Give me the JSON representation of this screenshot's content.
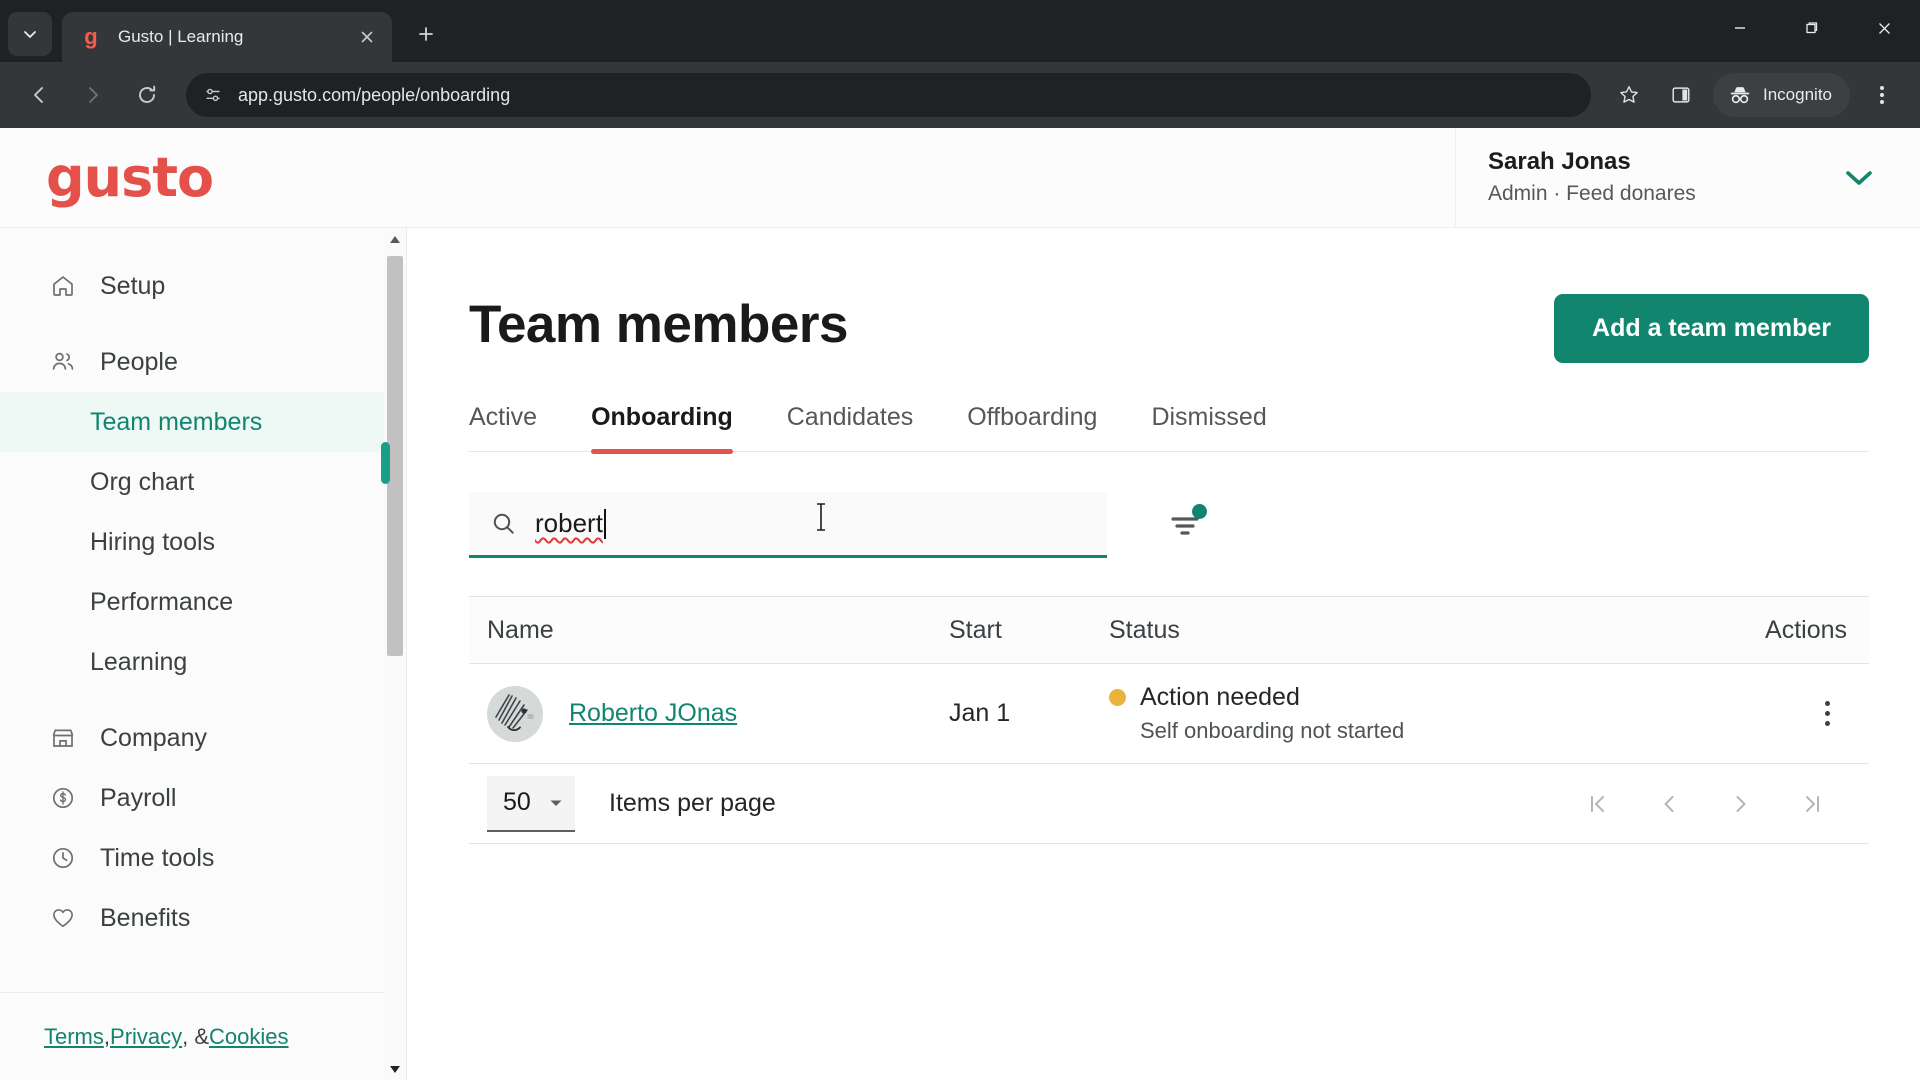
{
  "browser": {
    "tab": {
      "title": "Gusto | Learning",
      "favicon_letter": "g",
      "close_icon": "close-icon"
    },
    "new_tab_label": "+",
    "url": "app.gusto.com/people/onboarding",
    "incognito_label": "Incognito",
    "icons": {
      "tab_search": "chevron-down-icon",
      "back": "back-arrow-icon",
      "forward": "forward-arrow-icon",
      "reload": "reload-icon",
      "site_info": "site-settings-icon",
      "bookmark": "star-icon",
      "side_panel": "side-panel-icon",
      "incognito": "incognito-icon",
      "menu": "three-dot-menu-icon",
      "minimize": "minimize-icon",
      "maximize": "maximize-icon",
      "close": "window-close-icon"
    }
  },
  "header": {
    "logo_text": "gusto",
    "user_name": "Sarah Jonas",
    "user_role": "Admin · Feed donares",
    "chevron_color": "#12856f"
  },
  "sidebar": {
    "items": [
      {
        "label": "Setup",
        "icon": "home-icon",
        "type": "top"
      },
      {
        "label": "People",
        "icon": "people-icon",
        "type": "top"
      },
      {
        "label": "Team members",
        "type": "sub",
        "active": true
      },
      {
        "label": "Org chart",
        "type": "sub",
        "active": false
      },
      {
        "label": "Hiring tools",
        "type": "sub",
        "active": false
      },
      {
        "label": "Performance",
        "type": "sub",
        "active": false
      },
      {
        "label": "Learning",
        "type": "sub",
        "active": false
      },
      {
        "label": "Company",
        "icon": "store-icon",
        "type": "top"
      },
      {
        "label": "Payroll",
        "icon": "dollar-circle-icon",
        "type": "top"
      },
      {
        "label": "Time tools",
        "icon": "clock-icon",
        "type": "top"
      },
      {
        "label": "Benefits",
        "icon": "heart-icon",
        "type": "top"
      }
    ],
    "footer": {
      "terms": "Terms",
      "sep1": ", ",
      "privacy": "Privacy",
      "sep2": ", & ",
      "cookies": "Cookies"
    }
  },
  "main": {
    "title": "Team members",
    "primary_button": "Add a team member",
    "tabs": [
      {
        "label": "Active",
        "active": false
      },
      {
        "label": "Onboarding",
        "active": true
      },
      {
        "label": "Candidates",
        "active": false
      },
      {
        "label": "Offboarding",
        "active": false
      },
      {
        "label": "Dismissed",
        "active": false
      }
    ],
    "search": {
      "value": "robert",
      "placeholder": "Search",
      "icon": "search-icon",
      "spellcheck_error": true
    },
    "filter": {
      "icon": "filter-icon",
      "has_badge": true,
      "badge_color": "#12856f"
    },
    "table": {
      "columns": [
        "Name",
        "Start",
        "Status",
        "Actions"
      ],
      "rows": [
        {
          "name": "Roberto JOnas",
          "start": "Jan 1",
          "status": "Action needed",
          "status_sub": "Self onboarding not started",
          "status_color": "#eab33c",
          "avatar": "user-avatar",
          "actions_icon": "kebab-menu-icon"
        }
      ]
    },
    "pagination": {
      "per_page_value": "50",
      "per_page_label": "Items per page",
      "first_icon": "first-page-icon",
      "prev_icon": "previous-page-icon",
      "next_icon": "next-page-icon",
      "last_icon": "last-page-icon"
    }
  }
}
